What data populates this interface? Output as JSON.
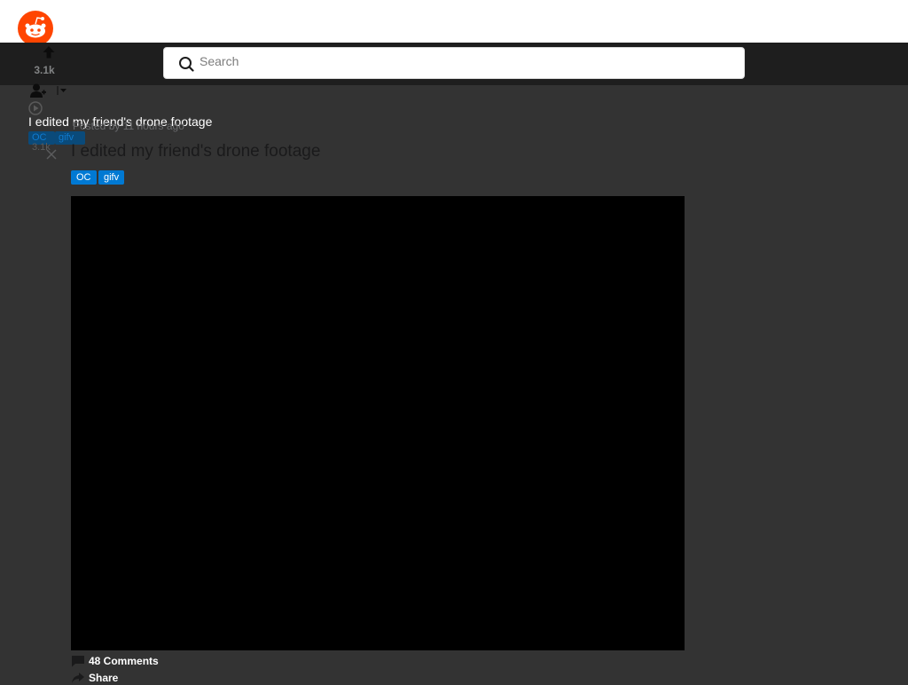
{
  "search": {
    "placeholder": "Search"
  },
  "card": {
    "score": "3.1k",
    "title": "I edited my friend's drone footage",
    "flairs": [
      "OC",
      "gifv"
    ],
    "score_small": "3.1k"
  },
  "post": {
    "posted_by": "Posted by  11 hours ago",
    "title": "I edited my friend's drone footage",
    "flairs": [
      "OC",
      "gifv"
    ],
    "comments_label": "48 Comments",
    "share_label": "Share"
  },
  "colors": {
    "brand": "#ff4500",
    "flair": "#0079d3",
    "background": "#333333",
    "media": "#000000"
  },
  "icons": [
    "reddit-logo-icon",
    "search-icon",
    "upvote-icon",
    "join-icon",
    "caret-down-icon",
    "play-icon",
    "close-icon",
    "comment-icon",
    "share-icon"
  ]
}
